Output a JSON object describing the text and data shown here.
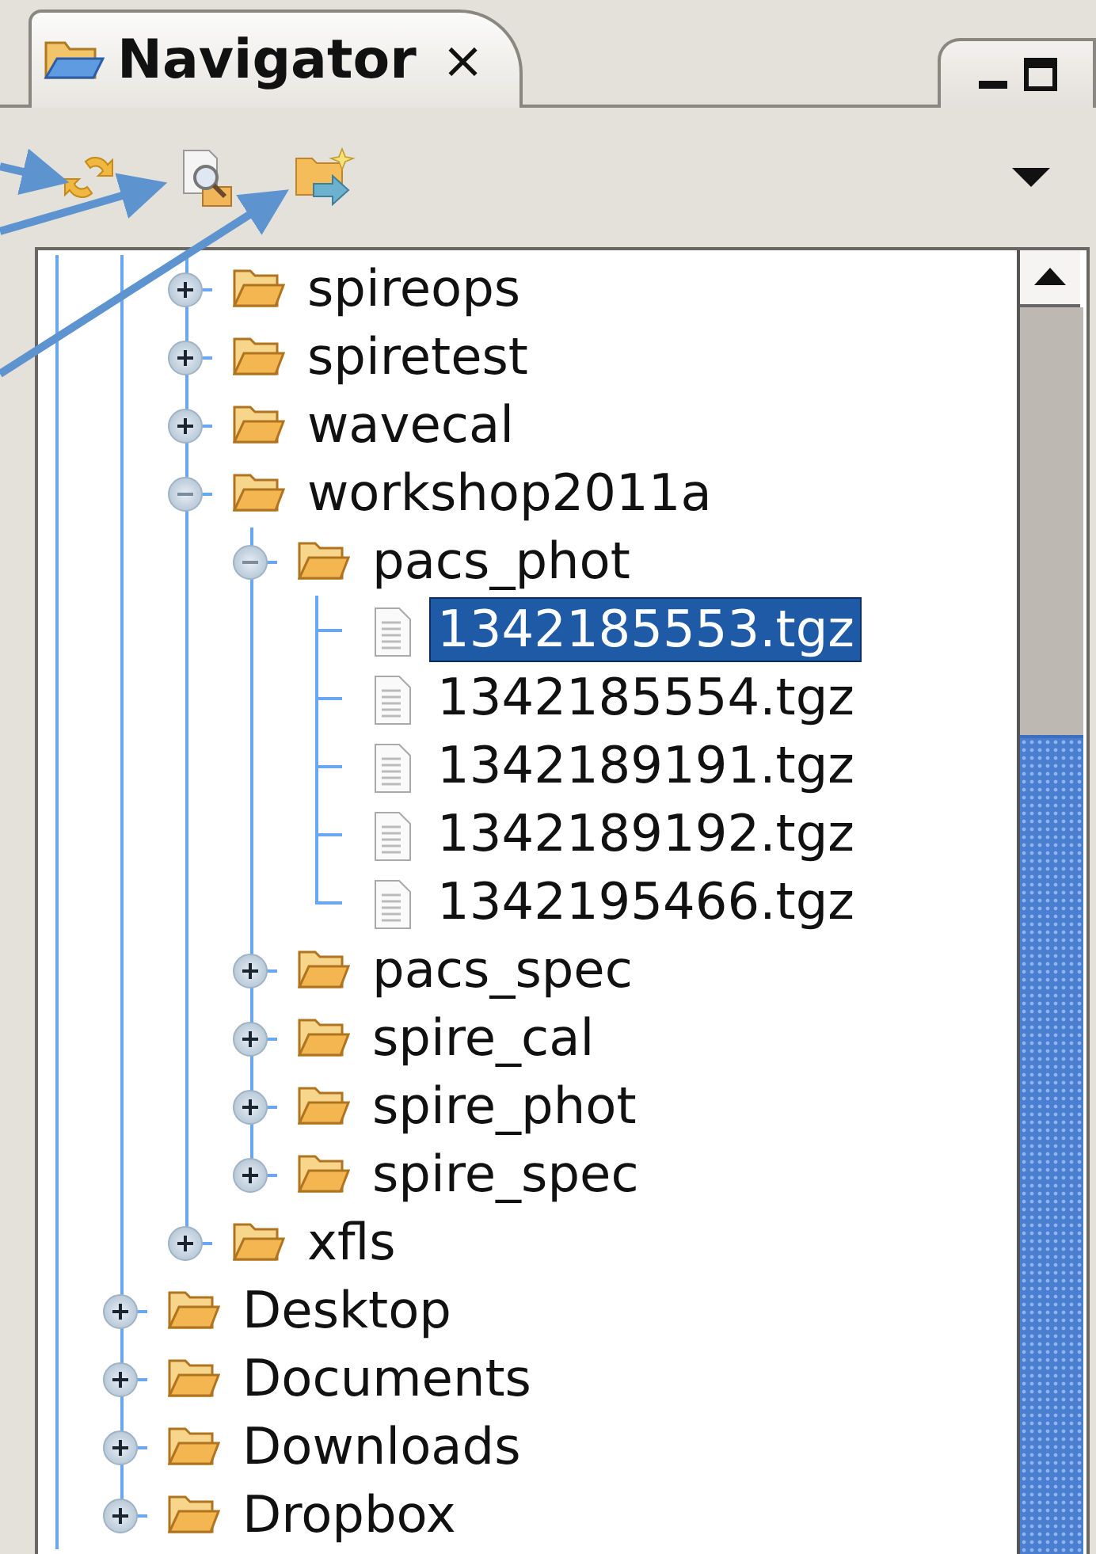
{
  "view_tab": {
    "title": "Navigator",
    "close": "×",
    "selected": true
  },
  "tree": {
    "continued_children": [
      {
        "name": "spireops",
        "kind": "folder",
        "expanded": false
      },
      {
        "name": "spiretest",
        "kind": "folder",
        "expanded": false
      },
      {
        "name": "wavecal",
        "kind": "folder",
        "expanded": false
      },
      {
        "name": "workshop2011a",
        "kind": "folder",
        "expanded": true,
        "children": [
          {
            "name": "pacs_phot",
            "kind": "folder",
            "expanded": true,
            "children": [
              {
                "name": "1342185553.tgz",
                "kind": "file",
                "selected": true
              },
              {
                "name": "1342185554.tgz",
                "kind": "file",
                "selected": false
              },
              {
                "name": "1342189191.tgz",
                "kind": "file",
                "selected": false
              },
              {
                "name": "1342189192.tgz",
                "kind": "file",
                "selected": false
              },
              {
                "name": "1342195466.tgz",
                "kind": "file",
                "selected": false
              }
            ]
          },
          {
            "name": "pacs_spec",
            "kind": "folder",
            "expanded": false
          },
          {
            "name": "spire_cal",
            "kind": "folder",
            "expanded": false
          },
          {
            "name": "spire_phot",
            "kind": "folder",
            "expanded": false
          },
          {
            "name": "spire_spec",
            "kind": "folder",
            "expanded": false
          }
        ]
      },
      {
        "name": "xfls",
        "kind": "folder",
        "expanded": false
      }
    ],
    "items": [
      {
        "name": "Desktop",
        "kind": "folder",
        "expanded": false
      },
      {
        "name": "Documents",
        "kind": "folder",
        "expanded": false
      },
      {
        "name": "Downloads",
        "kind": "folder",
        "expanded": false
      },
      {
        "name": "Dropbox",
        "kind": "folder",
        "expanded": false
      }
    ]
  }
}
